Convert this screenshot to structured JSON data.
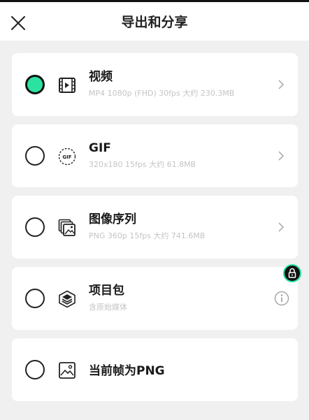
{
  "header": {
    "title": "导出和分享",
    "close_icon": "close-icon"
  },
  "options": [
    {
      "id": "video",
      "label": "视频",
      "sub": "MP4 1080p (FHD) 30fps 大约 230.3MB",
      "selected": true,
      "icon": "video-icon",
      "trailing": "chevron-right-icon"
    },
    {
      "id": "gif",
      "label": "GIF",
      "sub": "320x180 15fps 大约 61.8MB",
      "selected": false,
      "icon": "gif-icon",
      "trailing": "chevron-right-icon"
    },
    {
      "id": "image-sequence",
      "label": "图像序列",
      "sub": "PNG 360p 15fps 大约 741.6MB",
      "selected": false,
      "icon": "image-sequence-icon",
      "trailing": "chevron-right-icon"
    },
    {
      "id": "project-package",
      "label": "项目包",
      "sub": "含原始媒体",
      "selected": false,
      "icon": "project-package-icon",
      "trailing": "info-icon",
      "locked": true
    },
    {
      "id": "current-frame",
      "label": "当前帧为PNG",
      "sub": "",
      "selected": false,
      "icon": "image-icon",
      "trailing": ""
    }
  ],
  "colors": {
    "accent": "#2be3a0",
    "background": "#f0f0f0",
    "card": "#ffffff",
    "subtext": "#c4c4c4"
  }
}
